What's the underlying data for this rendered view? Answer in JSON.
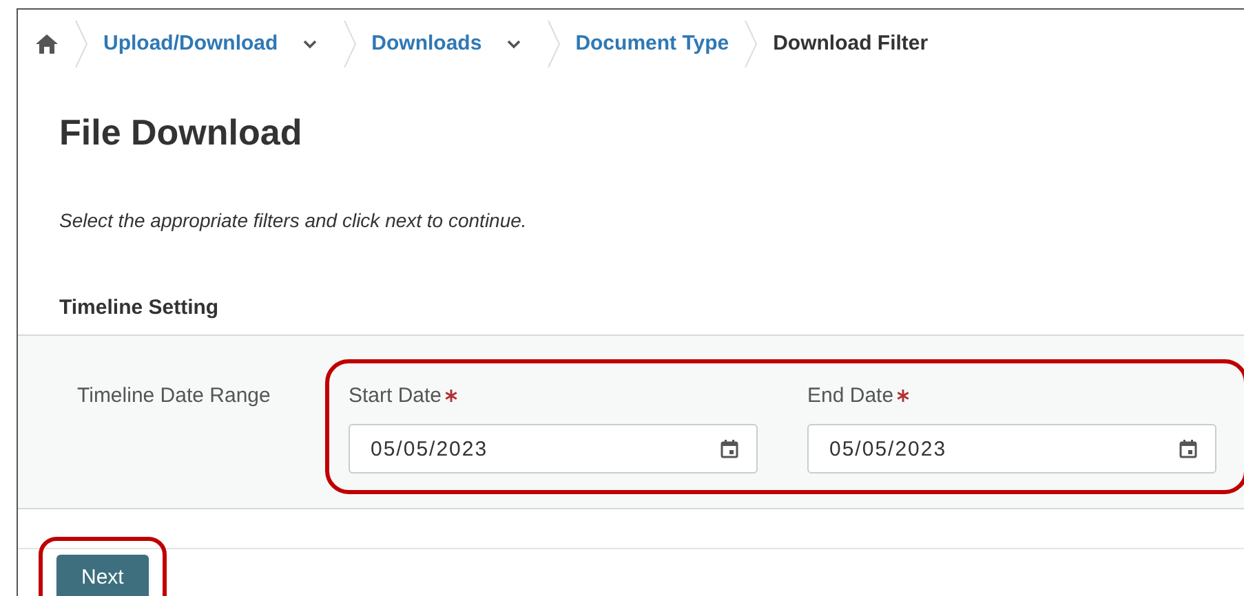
{
  "breadcrumb": [
    {
      "label": "Upload/Download",
      "link": true,
      "dropdown": true
    },
    {
      "label": "Downloads",
      "link": true,
      "dropdown": true
    },
    {
      "label": "Document Type",
      "link": true,
      "dropdown": false
    },
    {
      "label": "Download Filter",
      "link": false,
      "dropdown": false
    }
  ],
  "title": "File Download",
  "instructions": "Select the appropriate filters and click next to continue.",
  "section": {
    "title": "Timeline Setting",
    "row_label": "Timeline Date Range",
    "highlighted": true,
    "fields": [
      {
        "label": "Start Date",
        "required": true,
        "value": "05/05/2023"
      },
      {
        "label": "End Date",
        "required": true,
        "value": "05/05/2023"
      }
    ]
  },
  "next_button": {
    "label": "Next",
    "highlighted": true
  }
}
